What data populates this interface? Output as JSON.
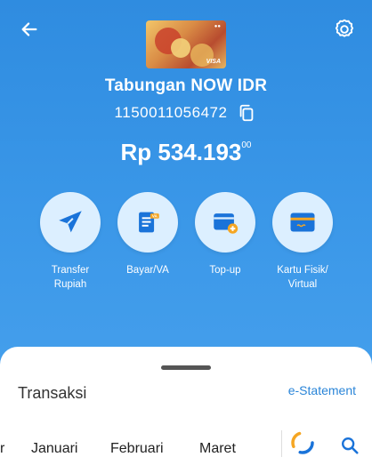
{
  "header": {
    "back_icon": "arrow-left-icon",
    "settings_icon": "gear-icon"
  },
  "account": {
    "name": "Tabungan NOW IDR",
    "number": "1150011056472",
    "balance_main": "Rp 534.193",
    "balance_cents": "00"
  },
  "actions": [
    {
      "label_line1": "Transfer",
      "label_line2": "Rupiah",
      "icon": "paper-plane-icon"
    },
    {
      "label_line1": "Bayar/VA",
      "label_line2": "",
      "icon": "bill-va-icon"
    },
    {
      "label_line1": "Top-up",
      "label_line2": "",
      "icon": "wallet-topup-icon"
    },
    {
      "label_line1": "Kartu Fisik/",
      "label_line2": "Virtual",
      "icon": "credit-card-icon"
    }
  ],
  "sheet": {
    "title": "Transaksi",
    "estatement_label": "e-Statement",
    "months": [
      "r",
      "Januari",
      "Februari",
      "Maret"
    ]
  },
  "colors": {
    "primary_blue": "#2f8ce0",
    "icon_blue": "#1a73d9",
    "circle_bg": "#dcefff",
    "accent_orange": "#f5a623"
  }
}
